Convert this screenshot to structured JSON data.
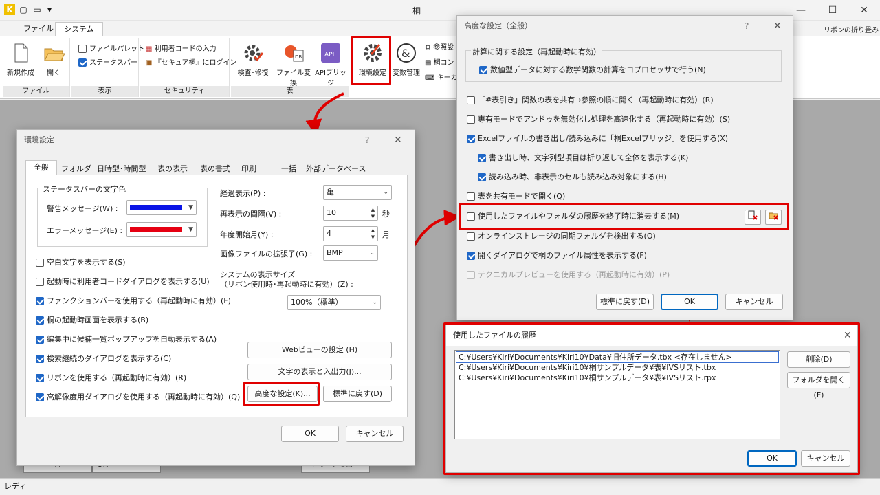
{
  "app": {
    "title": "桐",
    "qat_menu": "▾"
  },
  "window_controls": {
    "minimize": "—",
    "maximize": "☐",
    "close": "✕"
  },
  "ribbon": {
    "tabs": [
      "ファイル",
      "システム"
    ],
    "ribbon_collapse": "リボンの折り畳み",
    "groups": {
      "file": {
        "label": "ファイル",
        "new": "新規作成",
        "open": "開く"
      },
      "display": {
        "label": "表示",
        "file_palette": "ファイルパレット",
        "status_bar": "ステータスバー"
      },
      "security": {
        "label": "セキュリティ",
        "user_code": "利用者コードの入力",
        "secure_login": "『セキュア桐』にログイン"
      },
      "table": {
        "label": "表",
        "check_repair": "検査･修復",
        "file_convert": "ファイル変換",
        "api_bridge": "APIブリッジ",
        "api_icon_text": "API",
        "db_icon_text": "DB"
      },
      "env": {
        "env_settings": "環境設定",
        "var_manage": "変数管理",
        "ref": "参照設",
        "kiri_con": "桐コン",
        "key": "キーカ",
        "amp_icon_text": "&"
      }
    }
  },
  "env_dialog": {
    "title": "環境設定",
    "help": "?",
    "close": "✕",
    "tabs": [
      "全般",
      "フォルダ",
      "日時型･時間型",
      "表の表示",
      "表の書式",
      "印刷",
      "一括",
      "外部データベース"
    ],
    "statusbar_color": {
      "legend": "ステータスバーの文字色",
      "warning_label": "警告メッセージ(W) :",
      "error_label": "エラーメッセージ(E) :",
      "warning_color": "#0a14e6",
      "error_color": "#e60012"
    },
    "left_options": [
      {
        "label": "空白文字を表示する(S)",
        "checked": false
      },
      {
        "label": "起動時に利用者コードダイアログを表示する(U)",
        "checked": false
      },
      {
        "label": "ファンクションバーを使用する（再起動時に有効）(F)",
        "checked": true
      },
      {
        "label": "桐の起動時画面を表示する(B)",
        "checked": true
      },
      {
        "label": "編集中に候補一覧ポップアップを自動表示する(A)",
        "checked": true
      },
      {
        "label": "検索継続のダイアログを表示する(C)",
        "checked": true
      },
      {
        "label": "リボンを使用する（再起動時に有効）(R)",
        "checked": true
      },
      {
        "label": "高解像度用ダイアログを使用する（再起動時に有効）(Q)",
        "checked": true
      }
    ],
    "elapsed_label": "経過表示(P) :",
    "elapsed_value": "亀",
    "redisplay_label": "再表示の間隔(V) :",
    "redisplay_value": "10",
    "redisplay_unit": "秒",
    "year_start_label": "年度開始月(Y) :",
    "year_start_value": "4",
    "year_start_unit": "月",
    "image_ext_label": "画像ファイルの拡張子(G) :",
    "image_ext_value": "BMP",
    "sys_size_label1": "システムの表示サイズ",
    "sys_size_label2": "（リボン使用時･再起動時に有効）(Z) :",
    "sys_size_value": "100%（標準）",
    "web_view_btn": "Webビューの設定 (H)",
    "text_io_btn": "文字の表示と入出力(J)...",
    "advanced_btn": "高度な設定(K)...",
    "reset_btn": "標準に戻す(D)",
    "ok": "OK",
    "cancel": "キャンセル"
  },
  "adv_dialog": {
    "title": "高度な設定（全般）",
    "help": "?",
    "close": "✕",
    "calc_legend": "計算に関する設定（再起動時に有効）",
    "coprocessor": "数値型データに対する数学関数の計算をコプロセッサで行う(N)",
    "options": [
      {
        "label": "「#表引き」関数の表を共有→参照の順に開く（再起動時に有効）(R)",
        "checked": false,
        "disabled": false
      },
      {
        "label": "専有モードでアンドゥを無効化し処理を高速化する（再起動時に有効）(S)",
        "checked": false,
        "disabled": false
      },
      {
        "label": "Excelファイルの書き出し/読み込みに「桐Excelブリッジ」を使用する(X)",
        "checked": true,
        "disabled": false
      },
      {
        "label": "書き出し時、文字列型項目は折り返して全体を表示する(K)",
        "checked": true,
        "disabled": false
      },
      {
        "label": "読み込み時、非表示のセルも読み込み対象にする(H)",
        "checked": true,
        "disabled": false
      },
      {
        "label": "表を共有モードで開く(Q)",
        "checked": false,
        "disabled": false
      },
      {
        "label": "使用したファイルやフォルダの履歴を終了時に消去する(M)",
        "checked": false,
        "disabled": false
      },
      {
        "label": "オンラインストレージの同期フォルダを検出する(O)",
        "checked": false,
        "disabled": false
      },
      {
        "label": "開くダイアログで桐のファイル属性を表示する(F)",
        "checked": true,
        "disabled": false
      },
      {
        "label": "テクニカルプレビューを使用する（再起動時に有効）(P)",
        "checked": false,
        "disabled": true
      }
    ],
    "reset_btn": "標準に戻す(D)",
    "ok": "OK",
    "cancel": "キャンセル"
  },
  "history_dialog": {
    "title": "使用したファイルの履歴",
    "close": "✕",
    "items": [
      "C:¥Users¥Kiri¥Documents¥Kiri10¥Data¥旧住所データ.tbx  <存在しません>",
      "C:¥Users¥Kiri¥Documents¥Kiri10¥桐サンプルデータ¥表¥IVSリスト.tbx",
      "C:¥Users¥Kiri¥Documents¥Kiri10¥桐サンプルデータ¥表¥IVSリスト.rpx"
    ],
    "delete_btn": "削除(D)",
    "open_folder_btn": "フォルダを開く(F)",
    "ok": "OK",
    "cancel": "キャンセル"
  },
  "status": {
    "text": "レディ",
    "bottom_cells": [
      "A",
      "OK",
      "フォルダを開く"
    ]
  },
  "colors": {
    "highlight": "#e00000",
    "check_blue": "#1f67c7",
    "workspace": "#a9a9a9"
  }
}
